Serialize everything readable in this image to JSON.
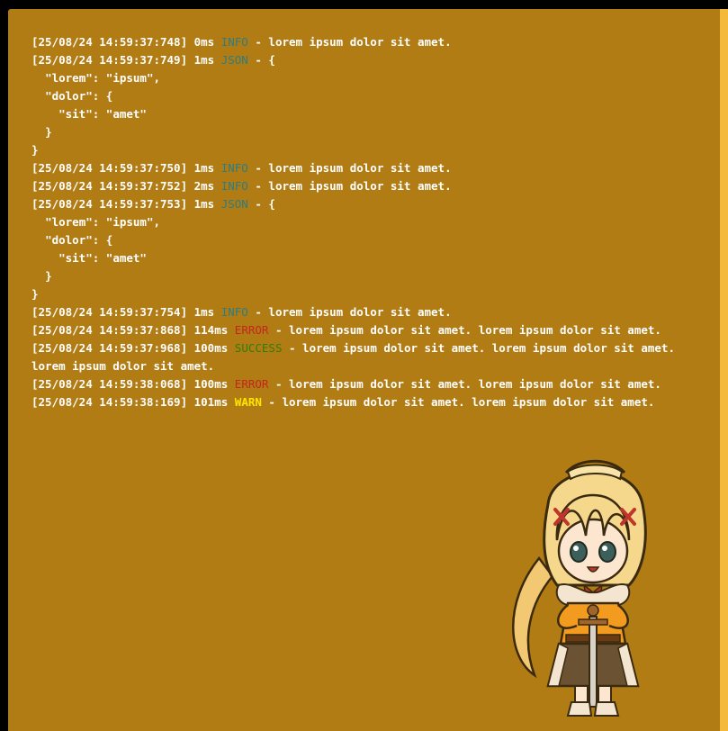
{
  "theme": {
    "background": "#b27c15",
    "edge": "#f4b93a",
    "text": "#ffffff",
    "info": "#2e7d80",
    "json": "#2e7d80",
    "error": "#c3261c",
    "success": "#2f7d0a",
    "warn": "#ffe600"
  },
  "log": [
    {
      "type": "entry",
      "ts": "[25/08/24 14:59:37:748]",
      "dur": "0ms",
      "level": "INFO",
      "levelClass": "info",
      "msg": " - lorem ipsum dolor sit amet."
    },
    {
      "type": "entry",
      "ts": "[25/08/24 14:59:37:749]",
      "dur": "1ms",
      "level": "JSON",
      "levelClass": "json",
      "msg": " - {"
    },
    {
      "type": "text",
      "text": "  \"lorem\": \"ipsum\","
    },
    {
      "type": "text",
      "text": "  \"dolor\": {"
    },
    {
      "type": "text",
      "text": "    \"sit\": \"amet\""
    },
    {
      "type": "text",
      "text": "  }"
    },
    {
      "type": "text",
      "text": "}"
    },
    {
      "type": "entry",
      "ts": "[25/08/24 14:59:37:750]",
      "dur": "1ms",
      "level": "INFO",
      "levelClass": "info",
      "msg": " - lorem ipsum dolor sit amet."
    },
    {
      "type": "entry",
      "ts": "[25/08/24 14:59:37:752]",
      "dur": "2ms",
      "level": "INFO",
      "levelClass": "info",
      "msg": " - lorem ipsum dolor sit amet."
    },
    {
      "type": "entry",
      "ts": "[25/08/24 14:59:37:753]",
      "dur": "1ms",
      "level": "JSON",
      "levelClass": "json",
      "msg": " - {"
    },
    {
      "type": "text",
      "text": "  \"lorem\": \"ipsum\","
    },
    {
      "type": "text",
      "text": "  \"dolor\": {"
    },
    {
      "type": "text",
      "text": "    \"sit\": \"amet\""
    },
    {
      "type": "text",
      "text": "  }"
    },
    {
      "type": "text",
      "text": "}"
    },
    {
      "type": "entry",
      "ts": "[25/08/24 14:59:37:754]",
      "dur": "1ms",
      "level": "INFO",
      "levelClass": "info",
      "msg": " - lorem ipsum dolor sit amet."
    },
    {
      "type": "entry",
      "ts": "[25/08/24 14:59:37:868]",
      "dur": "114ms",
      "level": "ERROR",
      "levelClass": "error",
      "msg": " - lorem ipsum dolor sit amet. lorem ipsum dolor sit amet."
    },
    {
      "type": "entry",
      "ts": "[25/08/24 14:59:37:968]",
      "dur": "100ms",
      "level": "SUCCESS",
      "levelClass": "success",
      "msg": " - lorem ipsum dolor sit amet. lorem ipsum dolor sit amet. lorem ipsum dolor sit amet."
    },
    {
      "type": "entry",
      "ts": "[25/08/24 14:59:38:068]",
      "dur": "100ms",
      "level": "ERROR",
      "levelClass": "error",
      "msg": " - lorem ipsum dolor sit amet. lorem ipsum dolor sit amet."
    },
    {
      "type": "entry",
      "ts": "[25/08/24 14:59:38:169]",
      "dur": "101ms",
      "level": "WARN",
      "levelClass": "warn",
      "msg": " - lorem ipsum dolor sit amet. lorem ipsum dolor sit amet."
    }
  ],
  "mascot": {
    "icon": "anime-character-mascot"
  }
}
